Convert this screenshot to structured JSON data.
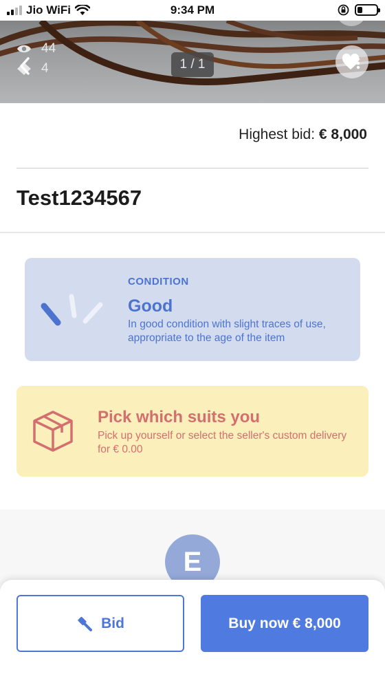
{
  "status_bar": {
    "carrier": "Jio WiFi",
    "time": "9:34 PM",
    "icons": [
      "signal-icon",
      "wifi-icon",
      "orientation-lock-icon",
      "battery-icon"
    ]
  },
  "gallery": {
    "views": "44",
    "likes": "4",
    "counter": "1 / 1",
    "icons": [
      "eye-icon",
      "tag-icon",
      "back-chevron-icon",
      "heart-more-icon"
    ]
  },
  "listing": {
    "highest_bid_label": "Highest bid:",
    "highest_bid_value": "€ 8,000",
    "title": "Test1234567"
  },
  "condition": {
    "label": "CONDITION",
    "value": "Good",
    "description": "In good condition with slight traces of use, appropriate to the age of the item",
    "icon": "condition-gauge-icon",
    "colors": {
      "background": "#d3dbef",
      "text": "#4c74cf"
    }
  },
  "delivery": {
    "title": "Pick which suits you",
    "description": "Pick up yourself or select the seller's custom delivery for € 0.00",
    "icon": "box-icon",
    "colors": {
      "background": "#fbefbb",
      "text": "#d36f6f"
    }
  },
  "seller": {
    "avatar_initial": "E"
  },
  "actions": {
    "bid_label": "Bid",
    "buy_label": "Buy now € 8,000",
    "bid_icon": "gavel-icon",
    "colors": {
      "primary": "#4f7adf"
    }
  }
}
